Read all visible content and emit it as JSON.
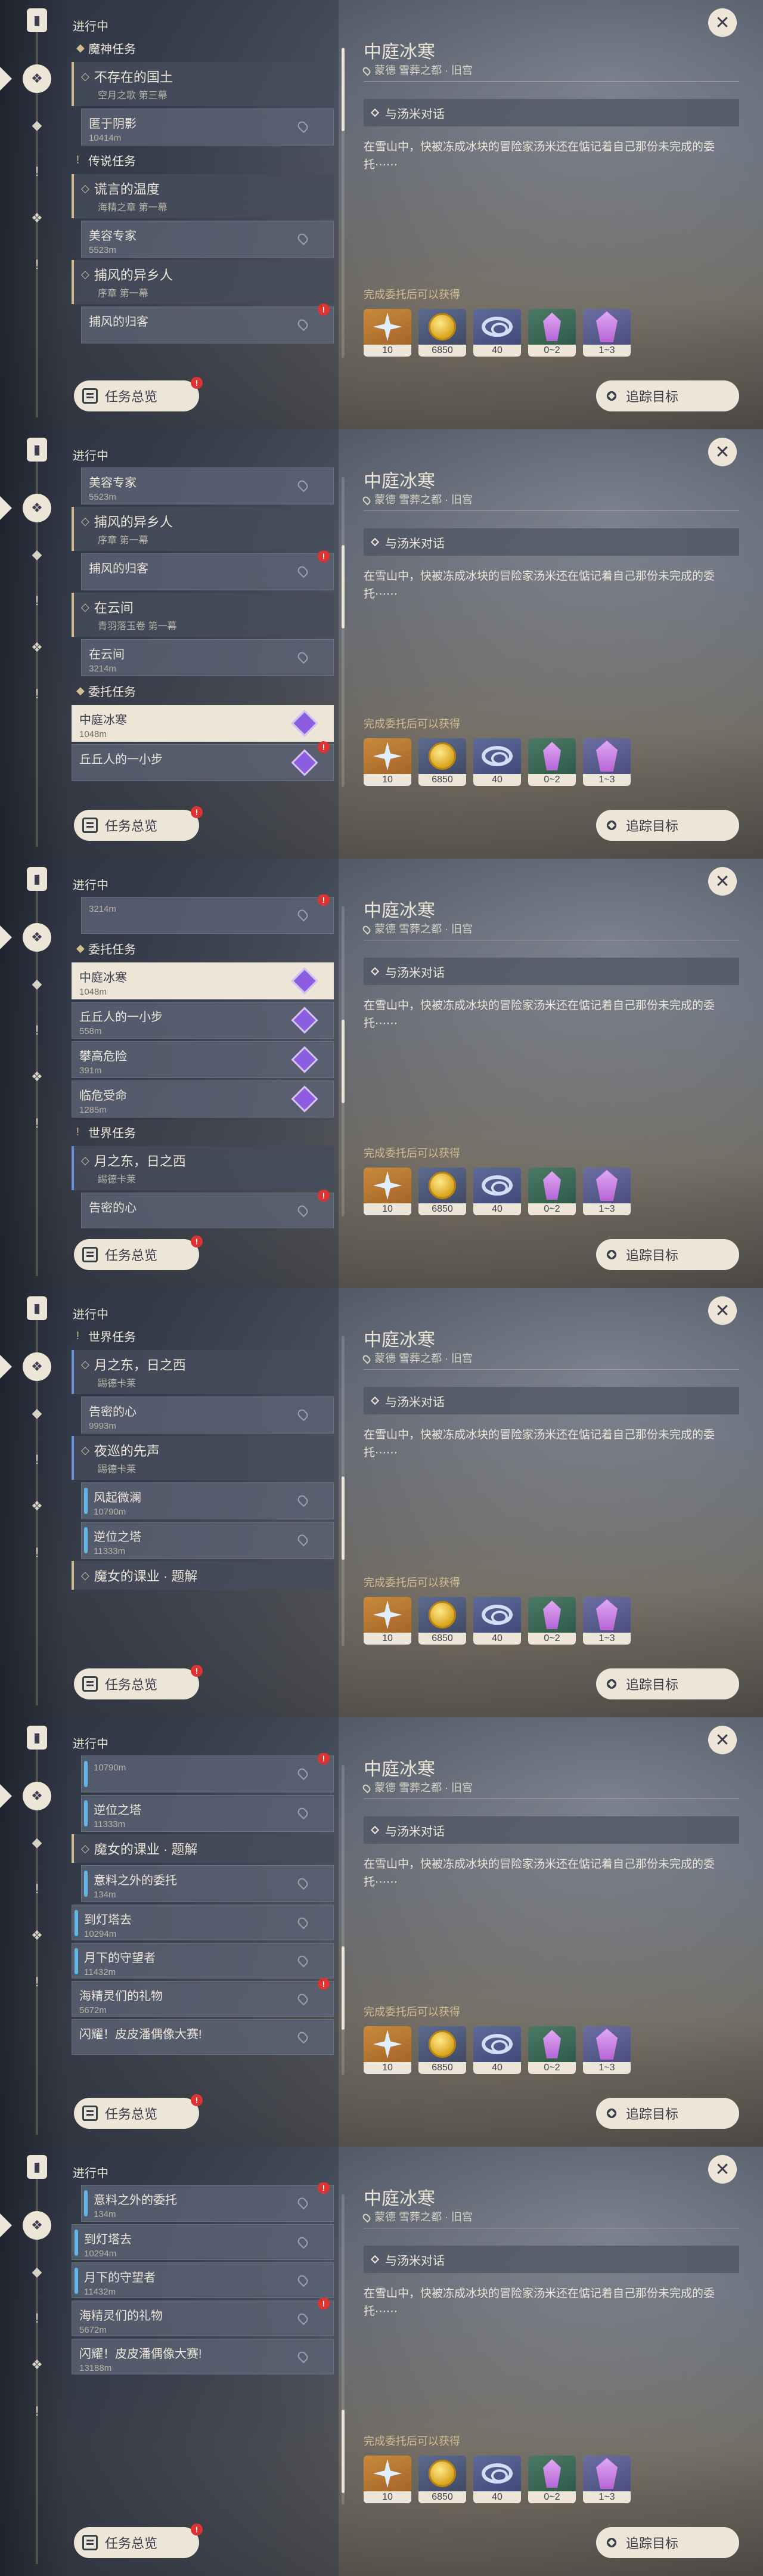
{
  "ui": {
    "panel_title": "进行中",
    "overview_label": "任务总览",
    "overview_badge": "!",
    "track_label": "追踪目标",
    "close_label": "✕"
  },
  "rail": {
    "icons": [
      "quest-book-icon",
      "all-quests-icon",
      "archon-quest-icon",
      "story-quest-icon",
      "world-quest-icon",
      "commission-icon"
    ]
  },
  "detail": {
    "title": "中庭冰寒",
    "location": "蒙德 雪葬之都 · 旧宫",
    "objective": "与汤米对话",
    "description": "在雪山中，快被冻成冰块的冒险家汤米还在惦记着自己那份未完成的委托⋯⋯",
    "rewards_label": "完成委托后可以获得",
    "rewards": [
      {
        "icon": "adventure-exp-icon",
        "count": "10"
      },
      {
        "icon": "mora-icon",
        "count": "6850"
      },
      {
        "icon": "friendship-exp-icon",
        "count": "40"
      },
      {
        "icon": "gem-fragment-icon",
        "count": "0~2"
      },
      {
        "icon": "crystal-icon",
        "count": "1~3"
      }
    ]
  },
  "frames": [
    {
      "rows": [
        {
          "kind": "section",
          "label": "魔神任务",
          "icon": "archon"
        },
        {
          "kind": "group",
          "name": "不存在的国土",
          "sub": "空月之歌 第三幕",
          "color": "gold"
        },
        {
          "kind": "item",
          "name": "匿于阴影",
          "dist": "10414m",
          "indent": true
        },
        {
          "kind": "section",
          "label": "传说任务",
          "icon": "story"
        },
        {
          "kind": "group",
          "name": "谎言的温度",
          "sub": "海精之章 第一幕",
          "color": "gold"
        },
        {
          "kind": "item",
          "name": "美容专家",
          "dist": "5523m",
          "indent": true
        },
        {
          "kind": "group",
          "name": "捕风的异乡人",
          "sub": "序章 第一幕",
          "color": "gold"
        },
        {
          "kind": "item",
          "name": "捕风的归客",
          "dist": "",
          "indent": true,
          "badge": "!"
        }
      ],
      "scroll": 0
    },
    {
      "rows": [
        {
          "kind": "item",
          "name": "美容专家",
          "dist": "5523m",
          "indent": true
        },
        {
          "kind": "group",
          "name": "捕风的异乡人",
          "sub": "序章 第一幕",
          "color": "gold"
        },
        {
          "kind": "item",
          "name": "捕风的归客",
          "dist": "",
          "indent": true,
          "badge": "!"
        },
        {
          "kind": "group",
          "name": "在云间",
          "sub": "青羽落玉卷 第一幕",
          "color": "gold"
        },
        {
          "kind": "item",
          "name": "在云间",
          "dist": "3214m",
          "indent": true
        },
        {
          "kind": "section",
          "label": "委托任务",
          "icon": "commission"
        },
        {
          "kind": "item",
          "name": "中庭冰寒",
          "dist": "1048m",
          "selected": true,
          "diamond": true
        },
        {
          "kind": "item",
          "name": "丘丘人的一小步",
          "dist": "",
          "diamond": true,
          "badge": "!"
        }
      ],
      "scroll": 0.3
    },
    {
      "rows": [
        {
          "kind": "item",
          "name": "",
          "dist": "3214m",
          "indent": true,
          "badge": "!"
        },
        {
          "kind": "section",
          "label": "委托任务",
          "icon": "commission"
        },
        {
          "kind": "item",
          "name": "中庭冰寒",
          "dist": "1048m",
          "selected": true,
          "diamond": true
        },
        {
          "kind": "item",
          "name": "丘丘人的一小步",
          "dist": "558m",
          "diamond": true
        },
        {
          "kind": "item",
          "name": "攀高危险",
          "dist": "391m",
          "diamond": true
        },
        {
          "kind": "item",
          "name": "临危受命",
          "dist": "1285m",
          "diamond": true
        },
        {
          "kind": "section",
          "label": "世界任务",
          "icon": "world"
        },
        {
          "kind": "group",
          "name": "月之东，日之西",
          "sub": "踢德卡莱",
          "color": "blue"
        },
        {
          "kind": "item",
          "name": "告密的心",
          "dist": "",
          "indent": true,
          "badge": "!"
        }
      ],
      "scroll": 0.5
    },
    {
      "rows": [
        {
          "kind": "section",
          "label": "世界任务",
          "icon": "world"
        },
        {
          "kind": "group",
          "name": "月之东，日之西",
          "sub": "踢德卡莱",
          "color": "blue"
        },
        {
          "kind": "item",
          "name": "告密的心",
          "dist": "9993m",
          "indent": true
        },
        {
          "kind": "group",
          "name": "夜巡的先声",
          "sub": "踢德卡莱",
          "color": "blue"
        },
        {
          "kind": "item",
          "name": "风起微澜",
          "dist": "10790m",
          "indent": true,
          "bar": true
        },
        {
          "kind": "item",
          "name": "逆位之塔",
          "dist": "11333m",
          "indent": true,
          "bar": true
        },
        {
          "kind": "group",
          "name": "魔女的课业 · 题解",
          "sub": "",
          "color": "gold"
        }
      ],
      "scroll": 0.62
    },
    {
      "rows": [
        {
          "kind": "item",
          "name": "",
          "dist": "10790m",
          "indent": true,
          "bar": true,
          "badge": "!"
        },
        {
          "kind": "item",
          "name": "逆位之塔",
          "dist": "11333m",
          "indent": true,
          "bar": true
        },
        {
          "kind": "group",
          "name": "魔女的课业 · 题解",
          "sub": "",
          "color": "gold"
        },
        {
          "kind": "item",
          "name": "意料之外的委托",
          "dist": "134m",
          "indent": true,
          "bar": true
        },
        {
          "kind": "item",
          "name": "到灯塔去",
          "dist": "10294m",
          "bar": true,
          "flat": true
        },
        {
          "kind": "item",
          "name": "月下的守望者",
          "dist": "11432m",
          "bar": true,
          "flat": true
        },
        {
          "kind": "item",
          "name": "海精灵们的礼物",
          "dist": "5672m",
          "flat": true,
          "badge": "!"
        },
        {
          "kind": "item",
          "name": "闪耀！皮皮潘偶像大赛!",
          "dist": "",
          "flat": true
        }
      ],
      "scroll": 0.8
    },
    {
      "rows": [
        {
          "kind": "item",
          "name": "意料之外的委托",
          "dist": "134m",
          "indent": true,
          "bar": true,
          "badge": "!"
        },
        {
          "kind": "item",
          "name": "到灯塔去",
          "dist": "10294m",
          "bar": true,
          "flat": true
        },
        {
          "kind": "item",
          "name": "月下的守望者",
          "dist": "11432m",
          "bar": true,
          "flat": true
        },
        {
          "kind": "item",
          "name": "海精灵们的礼物",
          "dist": "5672m",
          "flat": true,
          "badge": "!"
        },
        {
          "kind": "item",
          "name": "闪耀！皮皮潘偶像大赛!",
          "dist": "13188m",
          "flat": true
        }
      ],
      "scroll": 0.95
    }
  ]
}
